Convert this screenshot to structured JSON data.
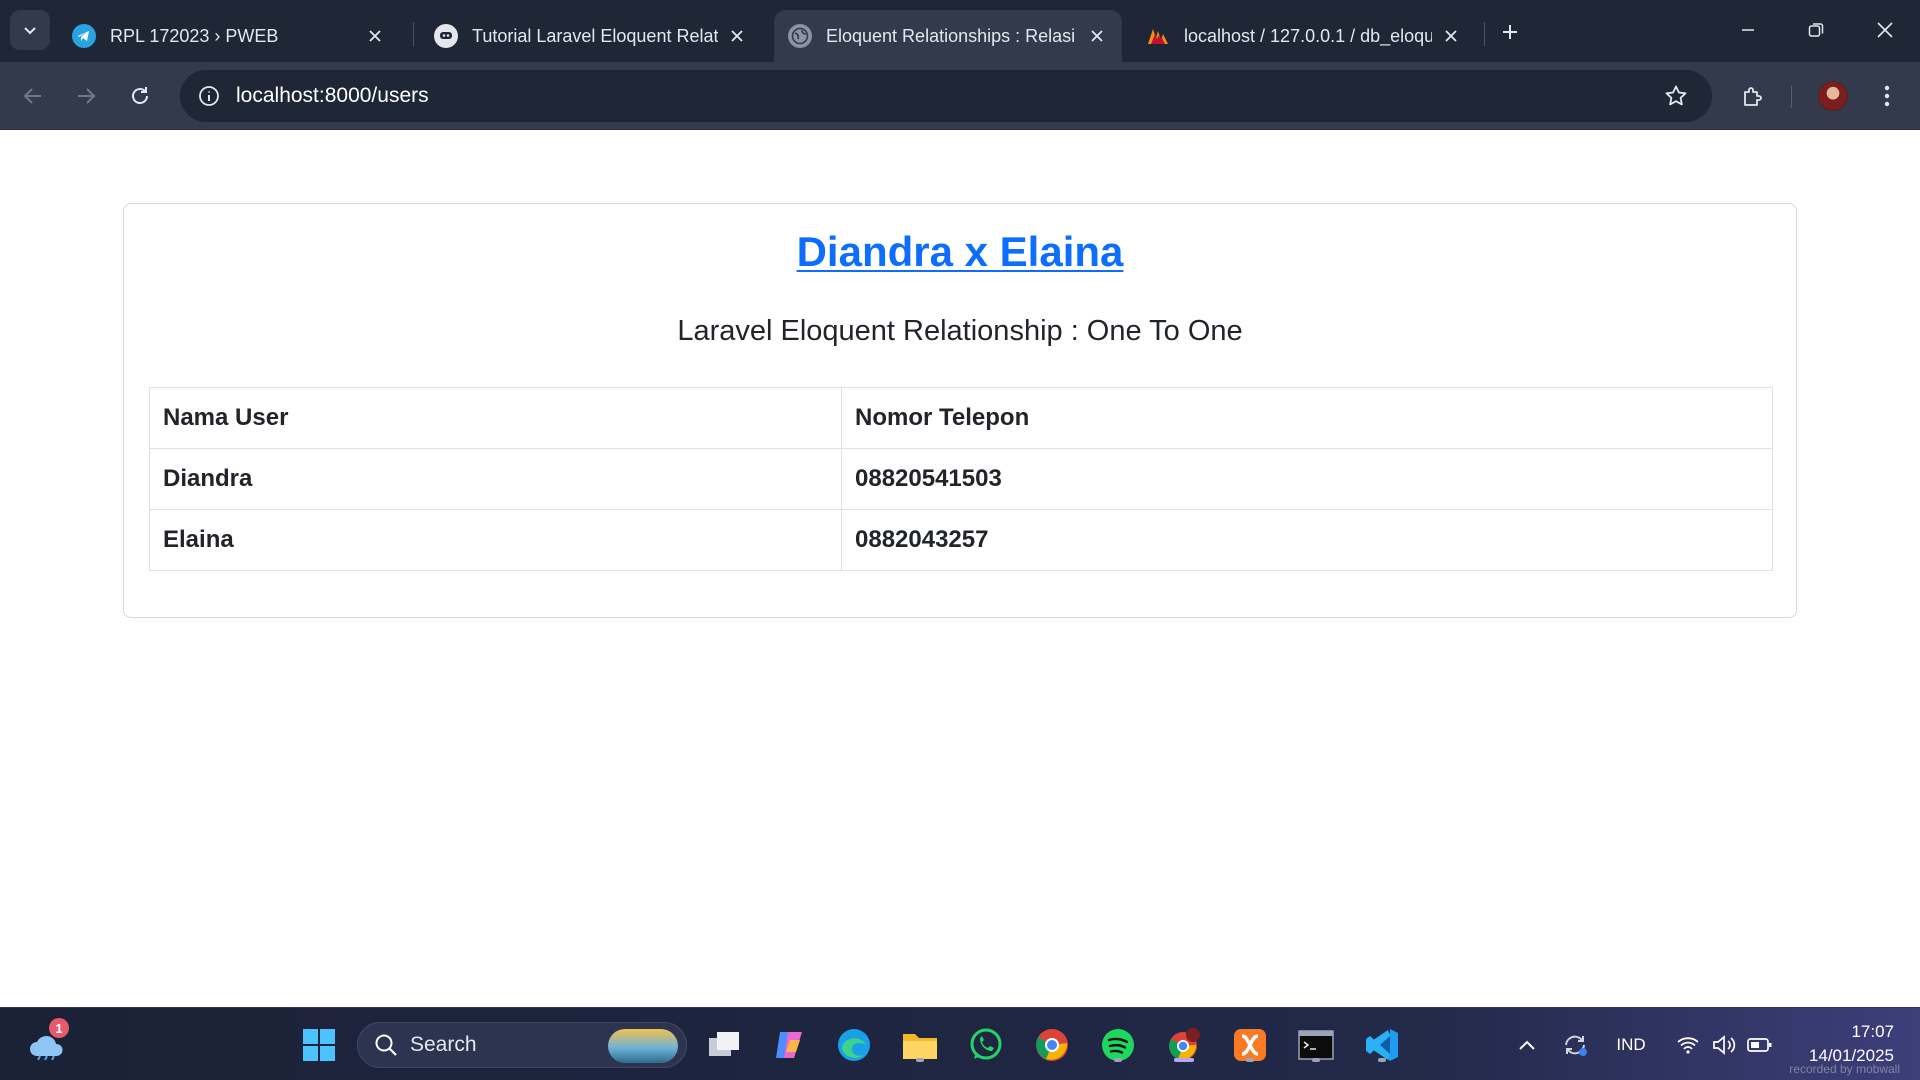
{
  "browser": {
    "tabs": [
      {
        "title": "RPL 172023 › PWEB",
        "icon": "telegram-icon",
        "active": false
      },
      {
        "title": "Tutorial Laravel Eloquent Relatio",
        "icon": "agent-icon",
        "active": false
      },
      {
        "title": "Eloquent Relationships : Relasi O",
        "icon": "globe-icon",
        "active": true
      },
      {
        "title": "localhost / 127.0.0.1 / db_eloqu",
        "icon": "phpmyadmin-icon",
        "active": false
      }
    ],
    "url": "localhost:8000/users"
  },
  "page": {
    "title": "Diandra x Elaina",
    "subtitle": "Laravel Eloquent Relationship : One To One",
    "table": {
      "headers": [
        "Nama User",
        "Nomor Telepon"
      ],
      "rows": [
        [
          "Diandra",
          "08820541503"
        ],
        [
          "Elaina",
          "0882043257"
        ]
      ]
    }
  },
  "taskbar": {
    "weather_badge": "1",
    "search_label": "Search",
    "language": "IND",
    "time": "17:07",
    "date": "14/01/2025",
    "watermark": "recorded by mobwall"
  },
  "colors": {
    "chrome_dark": "#1f2635",
    "chrome_mid": "#323a4b",
    "link": "#0d6efd",
    "text": "#212529"
  }
}
